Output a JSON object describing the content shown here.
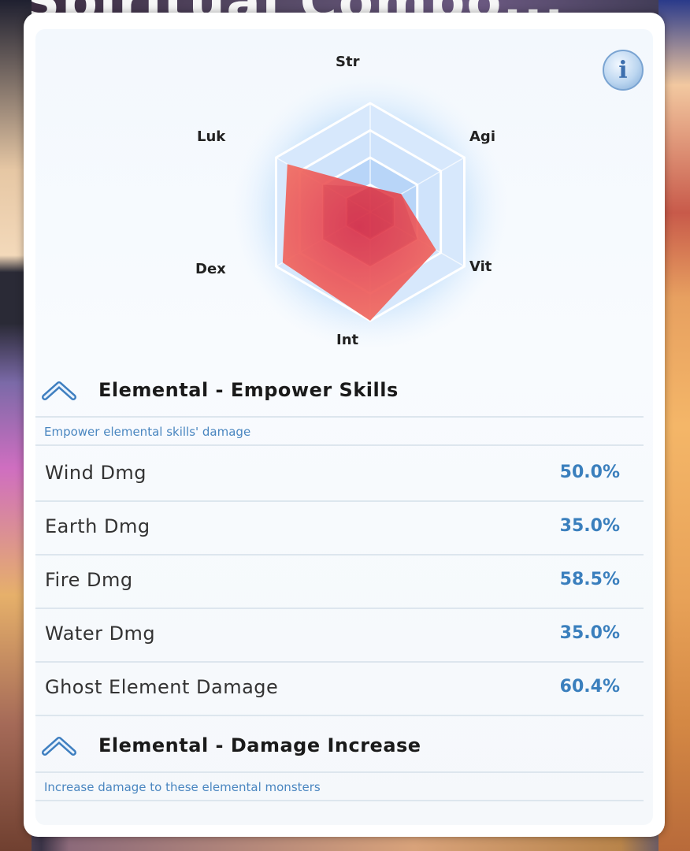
{
  "background": {
    "title_fragment": "Spiritual Combo..."
  },
  "panel": {
    "info_button_label": "i",
    "radar": {
      "axes": [
        "Str",
        "Agi",
        "Vit",
        "Int",
        "Dex",
        "Luk"
      ],
      "values": [
        0.23,
        0.33,
        0.7,
        1.0,
        0.93,
        0.88
      ],
      "fill_color": "#f0605a",
      "ring_colors": [
        "#cfe3fb",
        "#b8d5f8",
        "#9fc5f4"
      ]
    },
    "sections": [
      {
        "title": "Elemental - Empower Skills",
        "description": "Empower elemental skills' damage",
        "rows": [
          {
            "label": "Wind Dmg",
            "value": "50.0%"
          },
          {
            "label": "Earth Dmg",
            "value": "35.0%"
          },
          {
            "label": "Fire Dmg",
            "value": "58.5%"
          },
          {
            "label": "Water Dmg",
            "value": "35.0%"
          },
          {
            "label": "Ghost Element Damage",
            "value": "60.4%"
          }
        ]
      },
      {
        "title": "Elemental - Damage Increase",
        "description": "Increase damage to these elemental monsters"
      }
    ]
  }
}
